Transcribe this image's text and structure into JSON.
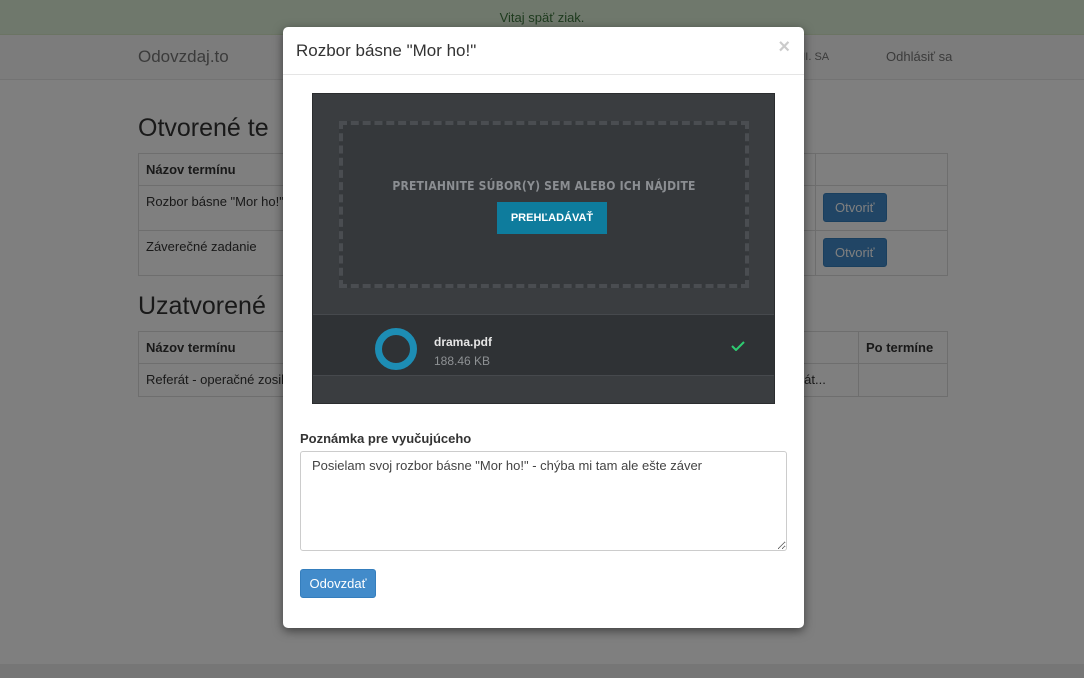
{
  "alert": {
    "text": "Vitaj späť ziak."
  },
  "navbar": {
    "brand": "Odovzdaj.to",
    "user": "., III. SA",
    "logout": "Odhlásiť sa"
  },
  "open_section": {
    "heading": "Otvorené te",
    "columns": [
      "Názov termínu"
    ],
    "rows": [
      {
        "name": "Rozbor básne \"Mor ho!\"",
        "action": "Otvoriť"
      },
      {
        "name": "Záverečné zadanie",
        "action": "Otvoriť"
      }
    ]
  },
  "closed_section": {
    "heading": "Uzatvorené",
    "columns": [
      "Názov termínu",
      "Po termíne"
    ],
    "rows": [
      {
        "name": "Referát - operačné zosil",
        "extra": "ferát..."
      }
    ]
  },
  "modal": {
    "title": "Rozbor básne \"Mor ho!\"",
    "close": "×",
    "uploader": {
      "drop_text": "PRETIAHNITE SÚBOR(Y) SEM ALEBO ICH NÁJDITE",
      "browse": "PREHĽADÁVAŤ",
      "file": {
        "name": "drama.pdf",
        "size": "188.46 KB"
      }
    },
    "note": {
      "label": "Poznámka pre vyučujúceho",
      "value": "Posielam svoj rozbor básne \"Mor ho!\" - chýba mi tam ale ešte záver"
    },
    "submit": "Odovzdať"
  }
}
